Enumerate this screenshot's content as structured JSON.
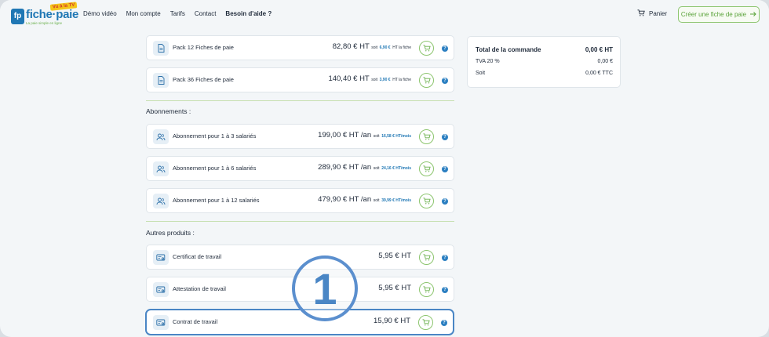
{
  "header": {
    "logo": {
      "name": "fiche·paie",
      "badge": "Vu à la TV",
      "mark": "fp",
      "tagline": "La paie simple en ligne"
    },
    "nav": [
      "Démo vidéo",
      "Mon compte",
      "Tarifs",
      "Contact",
      "Besoin d'aide ?"
    ],
    "cart_label": "Panier",
    "cta_label": "Créer une fiche de paie"
  },
  "packs": [
    {
      "name": "Pack 12 Fiches de paie",
      "price": "82,80 € HT",
      "soit": "soit",
      "unit_value": "6,90 €",
      "unit_suffix": "HT la fiche"
    },
    {
      "name": "Pack 36 Fiches de paie",
      "price": "140,40 € HT",
      "soit": "soit",
      "unit_value": "3,90 €",
      "unit_suffix": "HT la fiche"
    }
  ],
  "subscriptions_title": "Abonnements :",
  "subscriptions": [
    {
      "name": "Abonnement pour 1 à 3 salariés",
      "price": "199,00 € HT /an",
      "soit": "soit",
      "unit_value": "16,58 € HT/mois"
    },
    {
      "name": "Abonnement pour 1 à 6 salariés",
      "price": "289,90 € HT /an",
      "soit": "soit",
      "unit_value": "24,16 € HT/mois"
    },
    {
      "name": "Abonnement pour 1 à 12 salariés",
      "price": "479,90 € HT /an",
      "soit": "soit",
      "unit_value": "39,99 € HT/mois"
    }
  ],
  "others_title": "Autres produits :",
  "others": [
    {
      "name": "Certificat de travail",
      "price": "5,95 € HT"
    },
    {
      "name": "Attestation de travail",
      "price": "5,95 € HT"
    },
    {
      "name": "Contrat de travail",
      "price": "15,90 € HT"
    }
  ],
  "summary": {
    "total_label": "Total de la commande",
    "total_value": "0,00 € HT",
    "tva_label": "TVA 20 %",
    "tva_value": "0,00 €",
    "soit_label": "Soit",
    "soit_value": "0,00 € TTC"
  },
  "callout_number": "1",
  "colors": {
    "brand_blue": "#1f77b4",
    "brand_green": "#8cc56e",
    "highlight": "#4a86c5"
  }
}
